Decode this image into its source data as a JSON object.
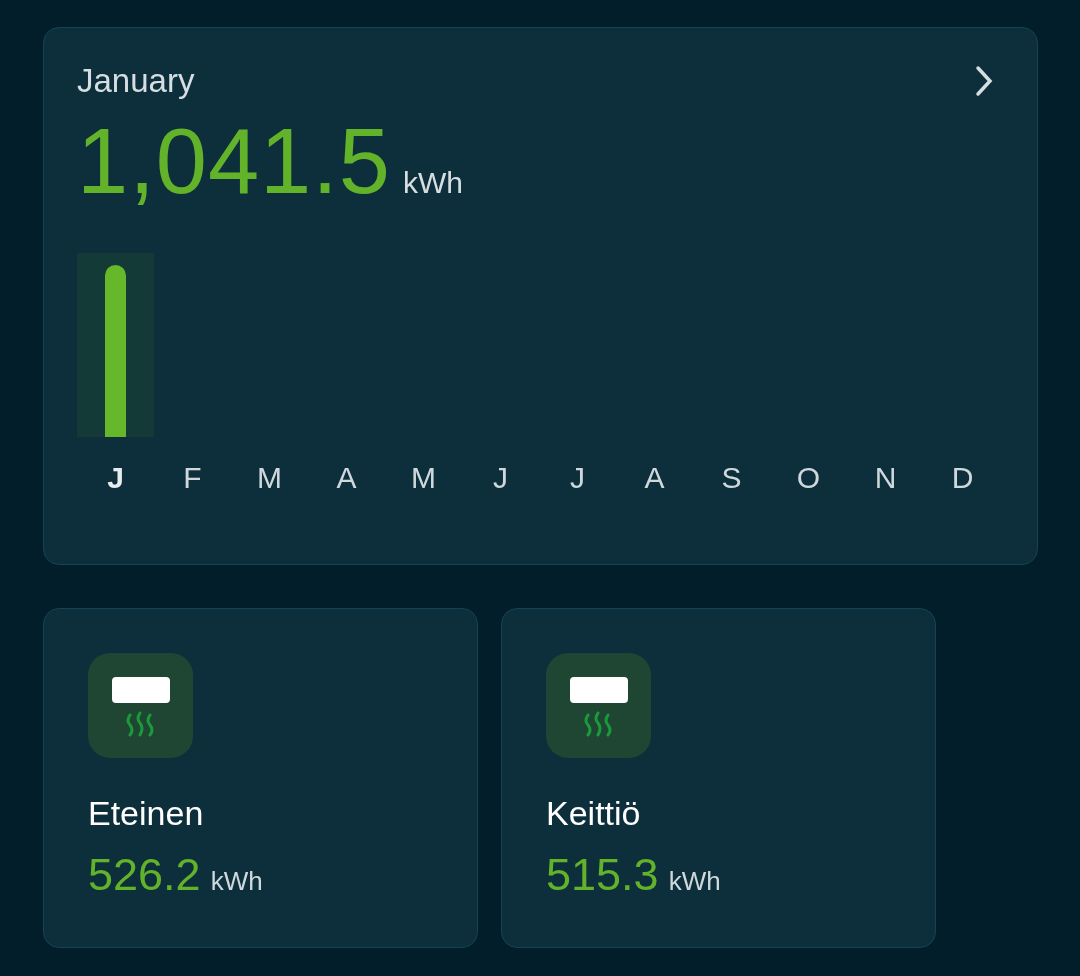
{
  "summary": {
    "period": "January",
    "total": "1,041.5",
    "unit": "kWh",
    "months": [
      {
        "label": "J",
        "selected": true
      },
      {
        "label": "F",
        "selected": false
      },
      {
        "label": "M",
        "selected": false
      },
      {
        "label": "A",
        "selected": false
      },
      {
        "label": "M",
        "selected": false
      },
      {
        "label": "J",
        "selected": false
      },
      {
        "label": "J",
        "selected": false
      },
      {
        "label": "A",
        "selected": false
      },
      {
        "label": "S",
        "selected": false
      },
      {
        "label": "O",
        "selected": false
      },
      {
        "label": "N",
        "selected": false
      },
      {
        "label": "D",
        "selected": false
      }
    ]
  },
  "devices": [
    {
      "name": "Eteinen",
      "value": "526.2",
      "unit": "kWh"
    },
    {
      "name": "Keittiö",
      "value": "515.3",
      "unit": "kWh"
    }
  ]
}
